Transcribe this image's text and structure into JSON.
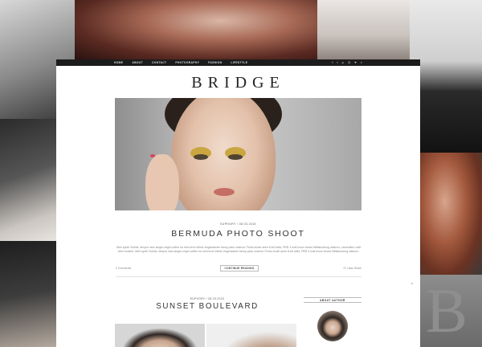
{
  "site": {
    "logo": "BRIDGE",
    "nav": [
      "HOME",
      "ABOUT",
      "CONTACT",
      "PHOTOGRAPHY",
      "FASHION",
      "LIFESTYLE"
    ],
    "social_icons": [
      "facebook-icon",
      "twitter-icon",
      "pinterest-icon",
      "instagram-icon",
      "heart-icon",
      "search-icon"
    ],
    "social_glyphs": [
      "f",
      "t",
      "p",
      "◎",
      "♥",
      "⌕"
    ]
  },
  "posts": [
    {
      "meta": "EUPHORY / 08.03.2015",
      "title": "BERMUDA PHOTO SHOOT",
      "excerpt": "Meh synth Schlitz, tempor duis single-origin coffee ea next level ethnic fingerstache fanny pack nostrud. Photo booth anim 8-bit hella, PBR 3 wolf moon beard Williamsburg ullamco, shoreditch craft beer tousled. Meh synth Schlitz, tempor duis single-origin coffee ea next level ethnic fingerstache fanny pack nostrud. Photo booth anim 8-bit hella, PBR 3 wolf moon beard Williamsburg ullamco.",
      "comments": "0 Comments",
      "continue": "CONTINUE READING",
      "likes": "37  Likes     Share"
    },
    {
      "meta": "EUPHORY / 08.03.2015",
      "title": "SUNSET BOULEVARD"
    }
  ],
  "sidebar": {
    "about_label": "ABOUT AUTHOR"
  },
  "background": {
    "watermark_letter": "B"
  }
}
